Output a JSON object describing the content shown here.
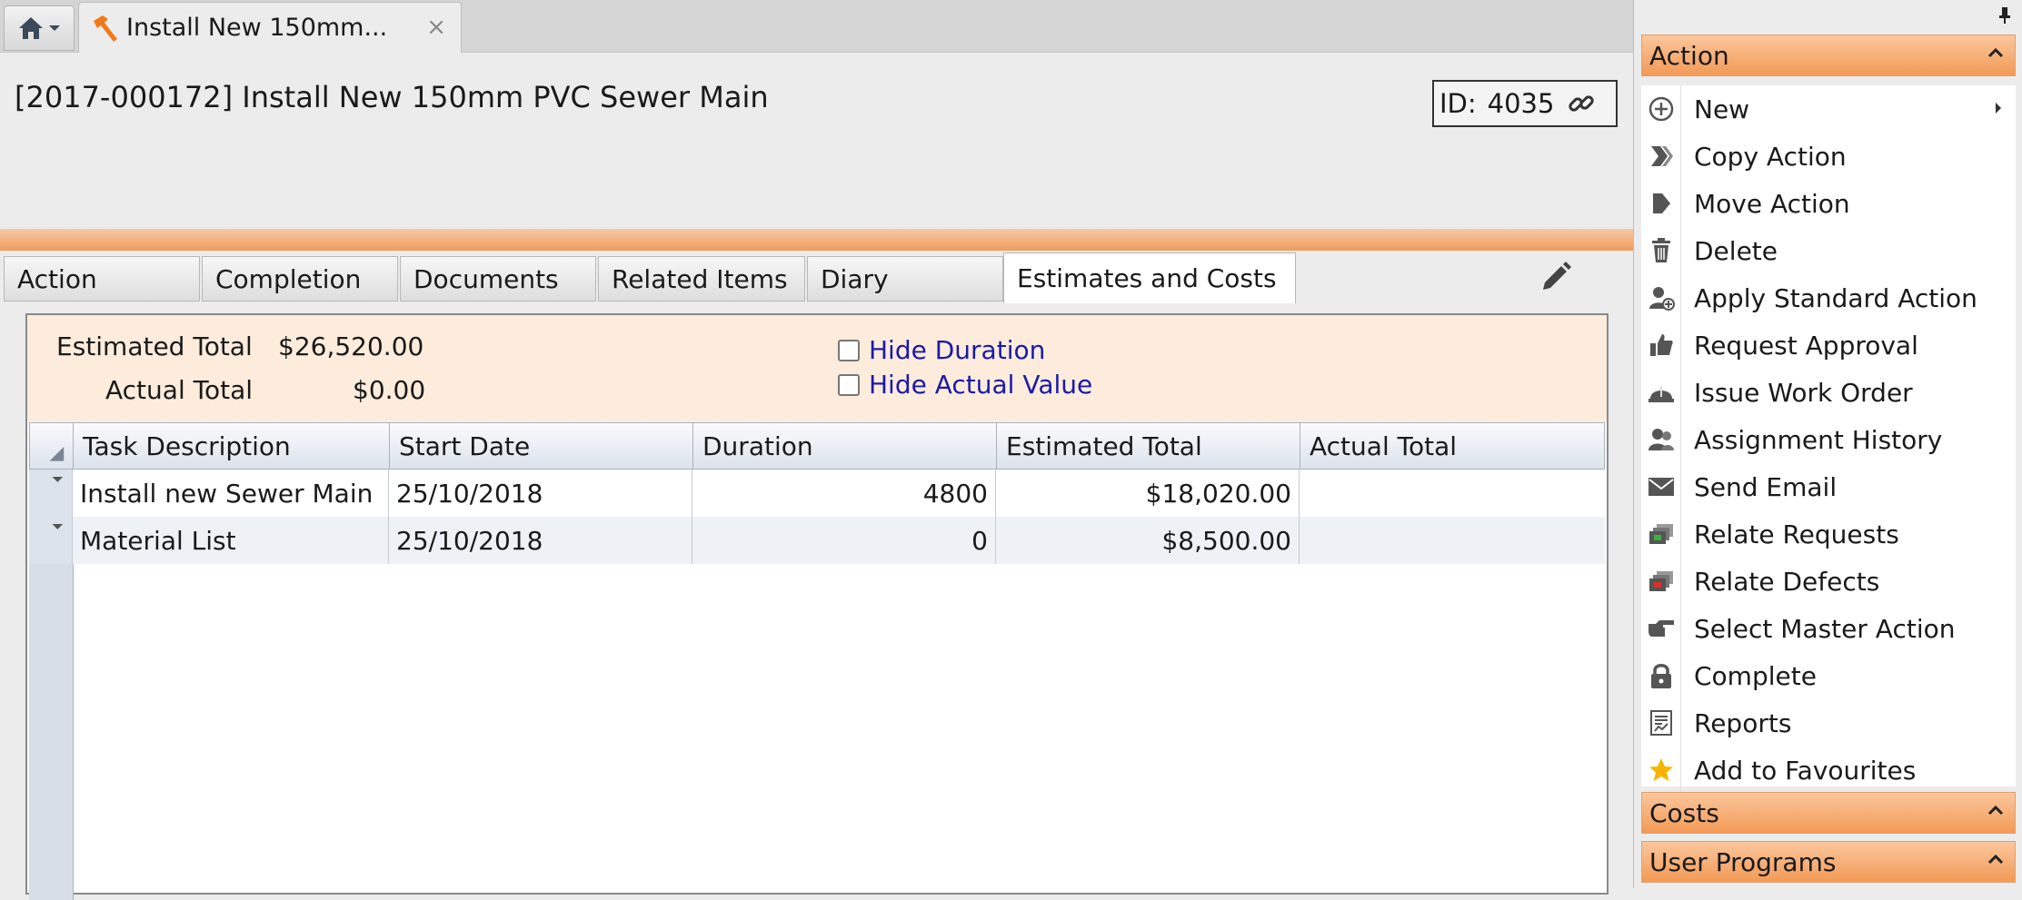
{
  "tabstrip": {
    "doc_tab_title": "Install New 150mm...",
    "close_glyph": "×"
  },
  "header": {
    "title": "[2017-000172] Install New 150mm PVC Sewer Main",
    "id_label": "ID:",
    "id_value": "4035"
  },
  "tabs": [
    {
      "label": "Action"
    },
    {
      "label": "Completion"
    },
    {
      "label": "Documents"
    },
    {
      "label": "Related Items"
    },
    {
      "label": "Diary"
    },
    {
      "label": "Estimates and Costs"
    }
  ],
  "summary": {
    "estimated_label": "Estimated Total",
    "estimated_value": "$26,520.00",
    "actual_label": "Actual Total",
    "actual_value": "$0.00",
    "hide_duration": "Hide Duration",
    "hide_actual": "Hide Actual Value"
  },
  "grid": {
    "columns": [
      "Task Description",
      "Start Date",
      "Duration",
      "Estimated Total",
      "Actual Total"
    ],
    "rows": [
      {
        "task": "Install new Sewer Main",
        "start": "25/10/2018",
        "duration": "4800",
        "estimated": "$18,020.00",
        "actual": ""
      },
      {
        "task": "Material List",
        "start": "25/10/2018",
        "duration": "0",
        "estimated": "$8,500.00",
        "actual": ""
      }
    ]
  },
  "side_panel": {
    "action_header": "Action",
    "items": [
      {
        "label": "New",
        "icon": "plus-circle-icon"
      },
      {
        "label": "Copy Action",
        "icon": "copy-icon"
      },
      {
        "label": "Move Action",
        "icon": "move-icon"
      },
      {
        "label": "Delete",
        "icon": "trash-icon"
      },
      {
        "label": "Apply Standard Action",
        "icon": "user-add-icon"
      },
      {
        "label": "Request Approval",
        "icon": "thumbs-up-icon"
      },
      {
        "label": "Issue Work Order",
        "icon": "hardhat-icon"
      },
      {
        "label": "Assignment History",
        "icon": "users-icon"
      },
      {
        "label": "Send Email",
        "icon": "envelope-icon"
      },
      {
        "label": "Relate Requests",
        "icon": "relate-requests-icon"
      },
      {
        "label": "Relate Defects",
        "icon": "relate-defects-icon"
      },
      {
        "label": "Select Master Action",
        "icon": "pointing-hand-icon"
      },
      {
        "label": "Complete",
        "icon": "lock-icon"
      },
      {
        "label": "Reports",
        "icon": "report-icon"
      },
      {
        "label": "Add to Favourites",
        "icon": "star-icon"
      }
    ],
    "costs_header": "Costs",
    "user_programs_header": "User Programs"
  },
  "colors": {
    "accent_orange": "#f39a57",
    "link_blue": "#1a1aa8",
    "star": "#f6b400"
  }
}
